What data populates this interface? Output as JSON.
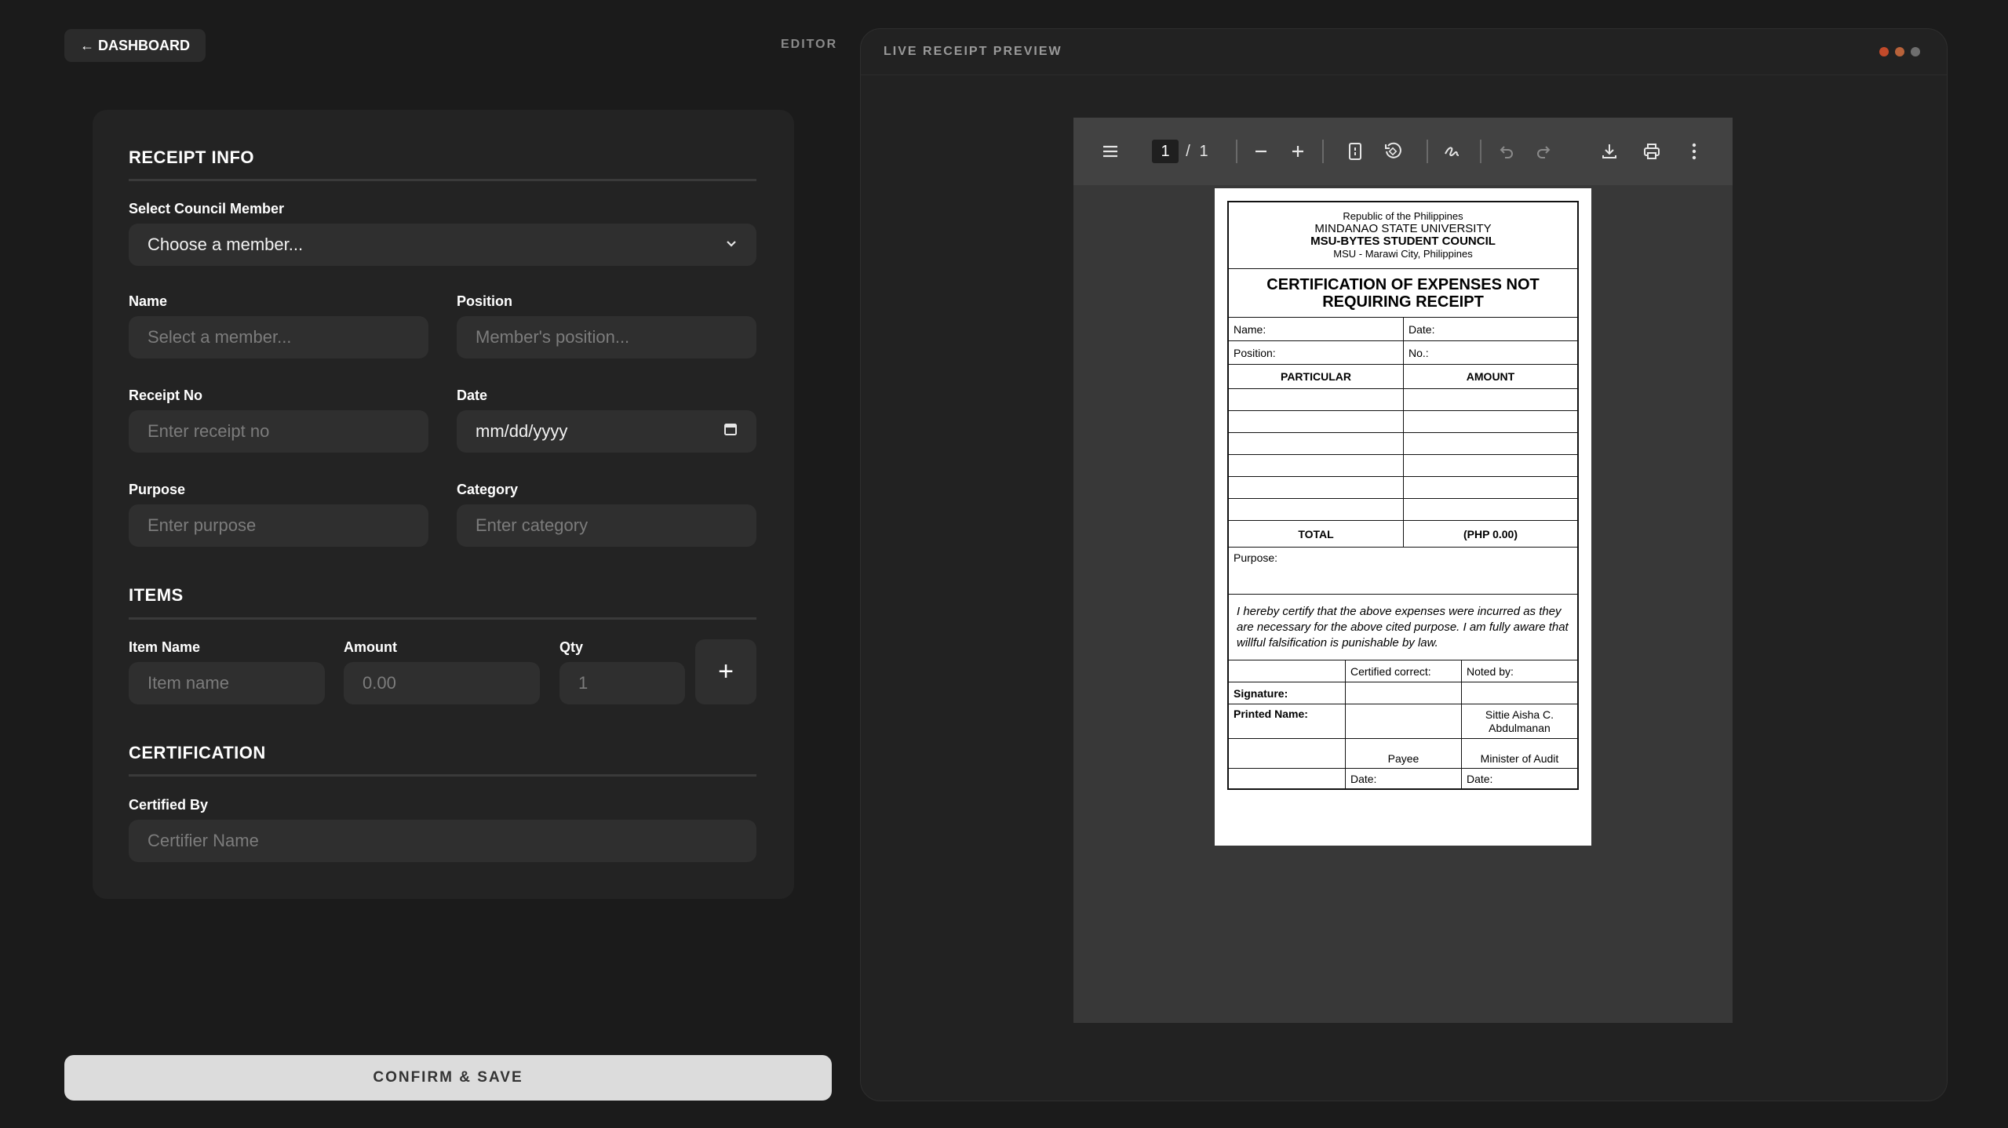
{
  "header": {
    "back_label": "← DASHBOARD",
    "editor_label": "EDITOR"
  },
  "form": {
    "receipt_info": {
      "title": "RECEIPT INFO",
      "member_label": "Select Council Member",
      "member_value": "Choose a member...",
      "name_label": "Name",
      "name_placeholder": "Select a member...",
      "position_label": "Position",
      "position_placeholder": "Member's position...",
      "receipt_no_label": "Receipt No",
      "receipt_no_placeholder": "Enter receipt no",
      "date_label": "Date",
      "date_value": "mm/dd/yyyy",
      "purpose_label": "Purpose",
      "purpose_placeholder": "Enter purpose",
      "category_label": "Category",
      "category_placeholder": "Enter category"
    },
    "items": {
      "title": "ITEMS",
      "item_name_label": "Item Name",
      "item_name_placeholder": "Item name",
      "amount_label": "Amount",
      "amount_placeholder": "0.00",
      "qty_label": "Qty",
      "qty_placeholder": "1",
      "add_symbol": "+"
    },
    "certification": {
      "title": "CERTIFICATION",
      "certified_by_label": "Certified By",
      "certified_by_placeholder": "Certifier Name"
    },
    "confirm_label": "CONFIRM & SAVE"
  },
  "preview": {
    "title": "LIVE RECEIPT PREVIEW",
    "dot_colors": [
      "#c24a2a",
      "#b8623a",
      "#6e6e6e"
    ],
    "toolbar": {
      "page_current": "1",
      "page_sep": "/",
      "page_total": "1"
    },
    "document": {
      "line1": "Republic of the Philippines",
      "line2": "MINDANAO STATE UNIVERSITY",
      "line3": "MSU-BYTES STUDENT COUNCIL",
      "line4": "MSU - Marawi City, Philippines",
      "title": "CERTIFICATION OF EXPENSES NOT REQUIRING RECEIPT",
      "name_label": "Name:",
      "date_label": "Date:",
      "position_label": "Position:",
      "no_label": "No.:",
      "col_particular": "PARTICULAR",
      "col_amount": "AMOUNT",
      "total_label": "TOTAL",
      "total_value": "(PHP 0.00)",
      "purpose_label": "Purpose:",
      "certify_text": "I hereby certify that the above expenses were incurred as they are necessary for the above cited purpose. I am fully aware that willful falsification is punishable by law.",
      "certified_correct": "Certified correct:",
      "noted_by": "Noted by:",
      "signature_label": "Signature:",
      "printed_name_label": "Printed Name:",
      "noted_name": "Sittie Aisha C. Abdulmanan",
      "payee": "Payee",
      "minister": "Minister of Audit",
      "date1": "Date:",
      "date2": "Date:"
    }
  }
}
